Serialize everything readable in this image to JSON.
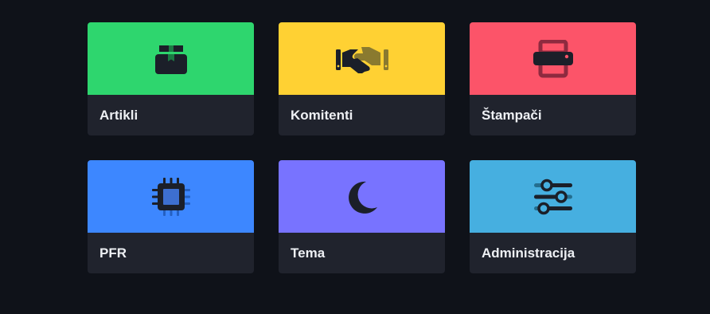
{
  "tiles": [
    {
      "label": "Artikli",
      "icon": "package-icon",
      "color": "#2ed66e"
    },
    {
      "label": "Komitenti",
      "icon": "handshake-icon",
      "color": "#ffd133"
    },
    {
      "label": "Štampači",
      "icon": "printer-icon",
      "color": "#fc5469"
    },
    {
      "label": "PFR",
      "icon": "chip-icon",
      "color": "#3d87ff"
    },
    {
      "label": "Tema",
      "icon": "moon-icon",
      "color": "#7873ff"
    },
    {
      "label": "Administracija",
      "icon": "sliders-icon",
      "color": "#46afe0"
    }
  ]
}
